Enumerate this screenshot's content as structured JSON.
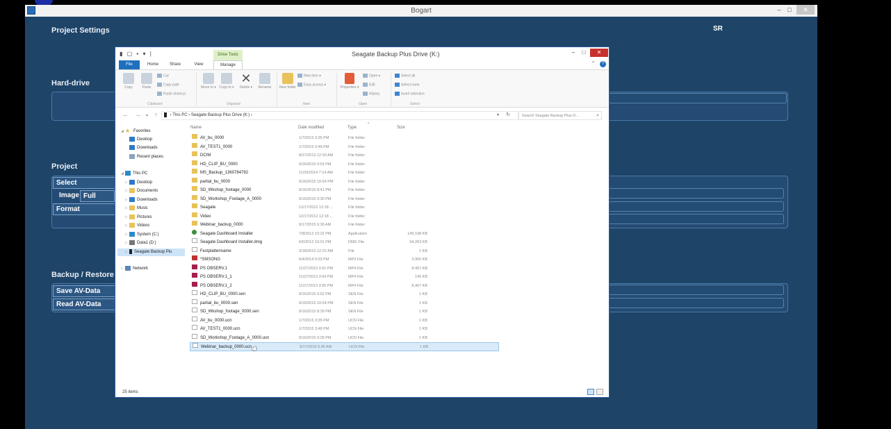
{
  "bogart": {
    "title": "Bogart",
    "win_min": "–",
    "win_max": "□",
    "win_close": "✕",
    "headings": {
      "project_settings": "Project Settings",
      "hard_drive": "Hard-drive",
      "project": "Project",
      "backup_restore": "Backup / Restore"
    },
    "user_badge": "SR",
    "buttons": {
      "select": "Select",
      "image": "Image",
      "image_value": "Full",
      "format": "Format",
      "save_av": "Save AV-Data",
      "read_av": "Read AV-Data"
    }
  },
  "explorer": {
    "title": "Seagate Backup Plus Drive (K:)",
    "quick_access": "▮ ▢ ▪ ▾ |",
    "context_tab": "Drive Tools",
    "win_min": "–",
    "win_max": "□",
    "win_close": "✕",
    "tabs": {
      "file": "File",
      "home": "Home",
      "share": "Share",
      "view": "View",
      "manage": "Manage"
    },
    "ribbon": {
      "copy": "Copy",
      "paste": "Paste",
      "cut": "Cut",
      "copy_path": "Copy path",
      "paste_shortcut": "Paste shortcut",
      "move_to": "Move to ▾",
      "copy_to": "Copy to ▾",
      "delete": "Delete ▾",
      "rename": "Rename",
      "new_folder": "New folder",
      "new_item": "New item ▾",
      "easy_access": "Easy access ▾",
      "properties": "Properties ▾",
      "open": "Open ▾",
      "edit": "Edit",
      "history": "History",
      "select_all": "Select all",
      "select_none": "Select none",
      "invert_selection": "Invert selection",
      "groups": {
        "clipboard": "Clipboard",
        "organize": "Organize",
        "new": "New",
        "open": "Open",
        "select": "Select"
      }
    },
    "address": {
      "path_this_pc": "This PC",
      "path_drive": "Seagate Backup Plus Drive (K:)",
      "search_placeholder": "Search Seagate Backup Plus D...",
      "back": "←",
      "forward": "→",
      "up": "↑",
      "chevron": "▾",
      "refresh": "↻",
      "sep": "›",
      "search_icon": "⌕"
    },
    "nav": {
      "favorites": "Favorites",
      "desktop": "Desktop",
      "downloads": "Downloads",
      "recent": "Recent places",
      "this_pc": "This PC",
      "pc_desktop": "Desktop",
      "documents": "Documents",
      "pc_downloads": "Downloads",
      "music": "Music",
      "pictures": "Pictures",
      "videos": "Videos",
      "system_c": "System (C:)",
      "data1_d": "Data1 (D:)",
      "seagate": "Seagate Backup Plu",
      "network": "Network",
      "expand_open": "◢",
      "expand_closed": "▷",
      "star": "★"
    },
    "columns": {
      "name": "Name",
      "date": "Date modified",
      "type": "Type",
      "size": "Size",
      "sort": "^"
    },
    "files": [
      {
        "name": "AV_bu_0000",
        "date": "1/7/2015 3:35 PM",
        "type": "File folder",
        "size": "",
        "icon": "folder"
      },
      {
        "name": "AV_TEST1_0000",
        "date": "1/7/2015 3:48 PM",
        "type": "File folder",
        "size": "",
        "icon": "folder"
      },
      {
        "name": "DCIM",
        "date": "8/27/2013 12:33 AM",
        "type": "File folder",
        "size": "",
        "icon": "folder"
      },
      {
        "name": "HD_CLIP_BU_0000",
        "date": "9/16/2015 9:53 PM",
        "type": "File folder",
        "size": "",
        "icon": "folder"
      },
      {
        "name": "MS_Backup_1360784792",
        "date": "11/29/2014 7:14 AM",
        "type": "File folder",
        "size": "",
        "icon": "folder"
      },
      {
        "name": "partial_bu_0000",
        "date": "9/16/2015 10:54 PM",
        "type": "File folder",
        "size": "",
        "icon": "folder"
      },
      {
        "name": "SD_Wkshop_footage_0000",
        "date": "9/16/2015 8:41 PM",
        "type": "File folder",
        "size": "",
        "icon": "folder"
      },
      {
        "name": "SD_Workshop_Footage_A_0000",
        "date": "9/16/2015 9:30 PM",
        "type": "File folder",
        "size": "",
        "icon": "folder"
      },
      {
        "name": "Seagate",
        "date": "12/17/2012 12:18 ...",
        "type": "File folder",
        "size": "",
        "icon": "folder"
      },
      {
        "name": "Video",
        "date": "12/17/2012 12:18 ...",
        "type": "File folder",
        "size": "",
        "icon": "folder"
      },
      {
        "name": "Webinar_backup_0000",
        "date": "9/17/2015 6:36 AM",
        "type": "File folder",
        "size": "",
        "icon": "folder"
      },
      {
        "name": "Seagate Dashboard Installer",
        "date": "7/8/2012 10:22 PM",
        "type": "Application",
        "size": "149,198 KB",
        "icon": "app"
      },
      {
        "name": "Seagate Dashboard Installer.dmg",
        "date": "6/6/2012 10:01 PM",
        "type": "DMG File",
        "size": "54,263 KB",
        "icon": "doc"
      },
      {
        "name": "Festplattenname",
        "date": "3/18/2013 12:22 AM",
        "type": "File",
        "size": "1 KB",
        "icon": "doc"
      },
      {
        "name": "*SMSONG",
        "date": "6/4/2014 5:03 PM",
        "type": "MP3 File",
        "size": "3,950 KB",
        "icon": "mp3"
      },
      {
        "name": "PS OBSERV.1",
        "date": "11/27/2013 3:51 PM",
        "type": "MP4 File",
        "size": "8,467 KB",
        "icon": "mp4"
      },
      {
        "name": "PS OBSERV.1_1",
        "date": "11/27/2013 3:54 PM",
        "type": "MP4 File",
        "size": "145 KB",
        "icon": "mp4"
      },
      {
        "name": "PS OBSERV.1_2",
        "date": "11/27/2013 3:55 PM",
        "type": "MP4 File",
        "size": "8,467 KB",
        "icon": "mp4"
      },
      {
        "name": "HD_CLIP_BU_0000.sen",
        "date": "9/16/2015 9:52 PM",
        "type": "SEN File",
        "size": "1 KB",
        "icon": "doc"
      },
      {
        "name": "partial_bu_0000.sen",
        "date": "9/16/2015 10:54 PM",
        "type": "SEN File",
        "size": "1 KB",
        "icon": "doc"
      },
      {
        "name": "SD_Wkshop_footage_0000.sen",
        "date": "9/16/2015 8:39 PM",
        "type": "SEN File",
        "size": "1 KB",
        "icon": "doc"
      },
      {
        "name": "AV_bu_0000.ucn",
        "date": "1/7/2015 3:35 PM",
        "type": "UCN File",
        "size": "1 KB",
        "icon": "doc"
      },
      {
        "name": "AV_TEST1_0000.ucn",
        "date": "1/7/2015 3:48 PM",
        "type": "UCN File",
        "size": "1 KB",
        "icon": "doc"
      },
      {
        "name": "SD_Workshop_Footage_A_0000.ucn",
        "date": "9/16/2015 9:29 PM",
        "type": "UCN File",
        "size": "1 KB",
        "icon": "doc"
      },
      {
        "name": "Webinar_backup_0000.ucn",
        "date": "9/17/2015 6:36 AM",
        "type": "UCN File",
        "size": "1 KB",
        "icon": "doc"
      }
    ],
    "selected_index": 24,
    "status": {
      "count": "25 items"
    }
  }
}
